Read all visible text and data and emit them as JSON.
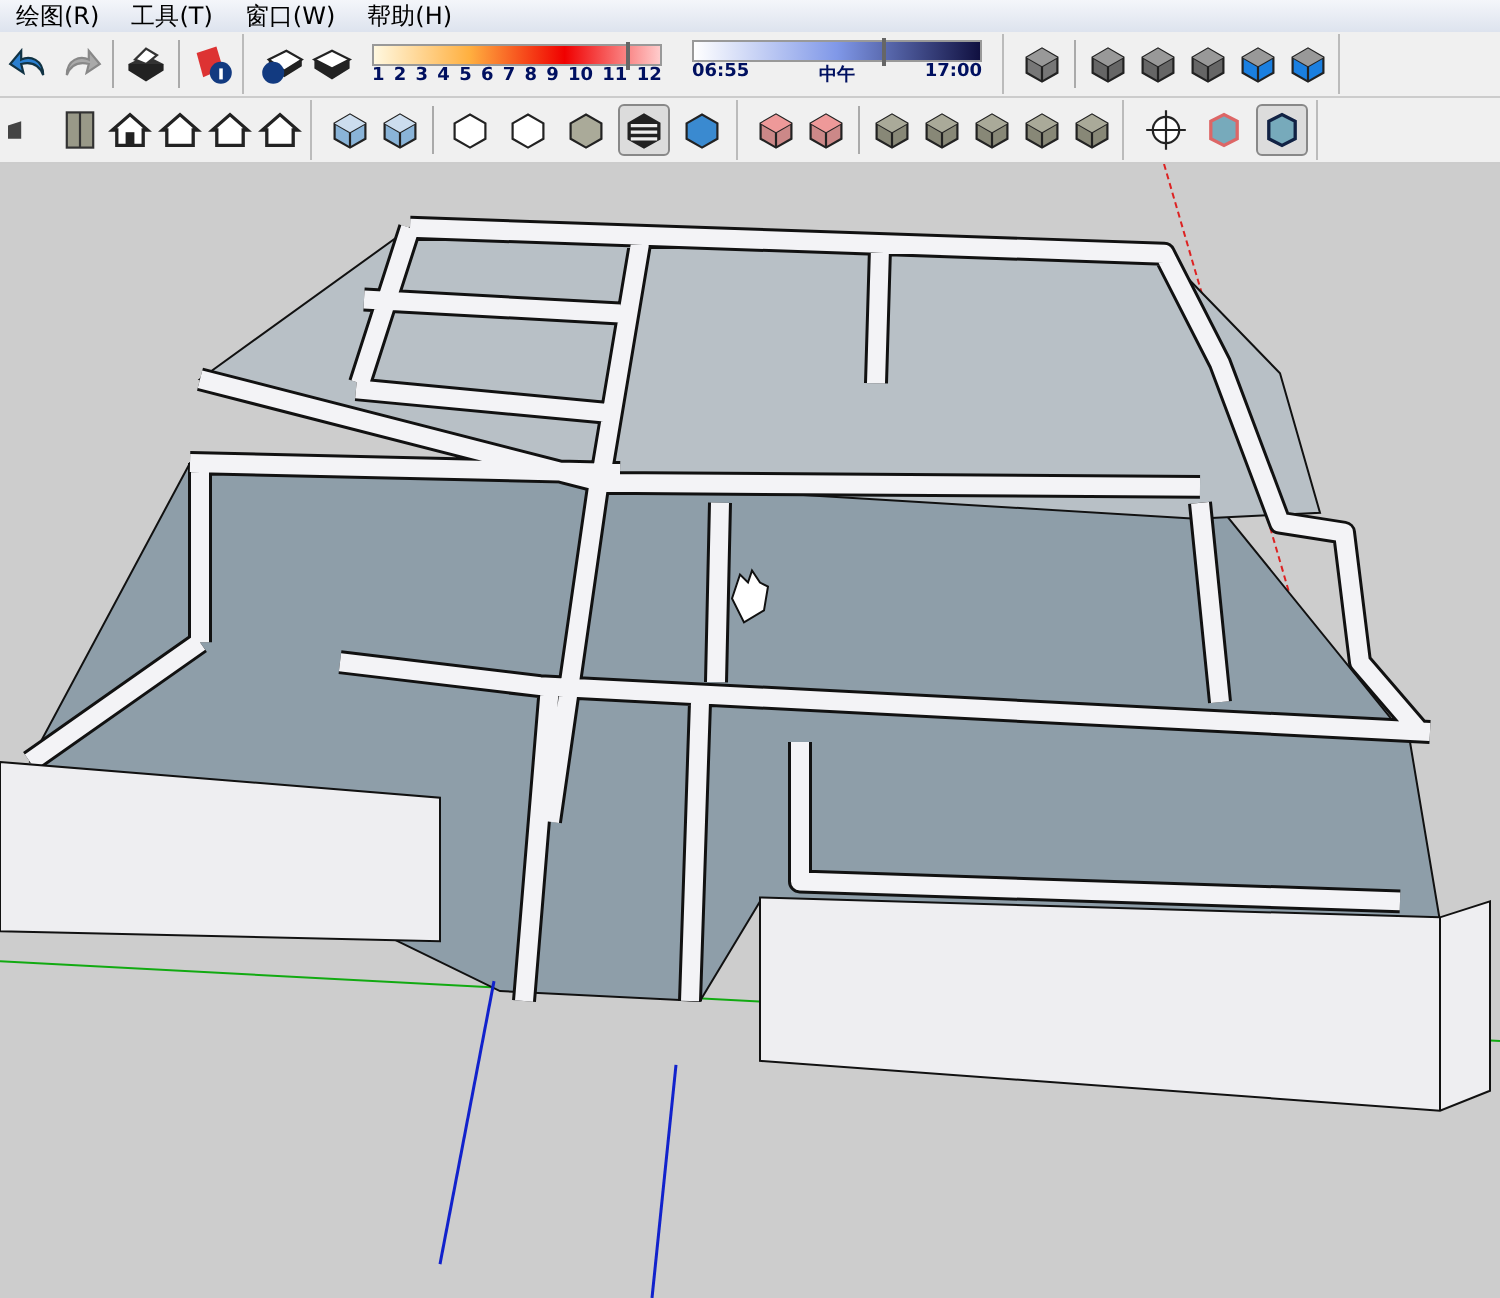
{
  "menu": [
    {
      "label": "绘图(R)"
    },
    {
      "label": "工具(T)"
    },
    {
      "label": "窗口(W)"
    },
    {
      "label": "帮助(H)"
    }
  ],
  "shadow_date": {
    "level": 0.88,
    "ticks": [
      "1",
      "2",
      "3",
      "4",
      "5",
      "6",
      "7",
      "8",
      "9",
      "10",
      "11",
      "12"
    ]
  },
  "shadow_time": {
    "level": 0.66,
    "start": "06:55",
    "middle": "中午",
    "end": "17:00"
  },
  "style_buttons": [
    {
      "selected": false
    },
    {
      "selected": false
    },
    {
      "selected": false
    },
    {
      "selected": true
    },
    {
      "selected": false
    }
  ],
  "view_buttons": [
    {
      "selected": false
    },
    {
      "selected": false
    },
    {
      "selected": true
    }
  ]
}
